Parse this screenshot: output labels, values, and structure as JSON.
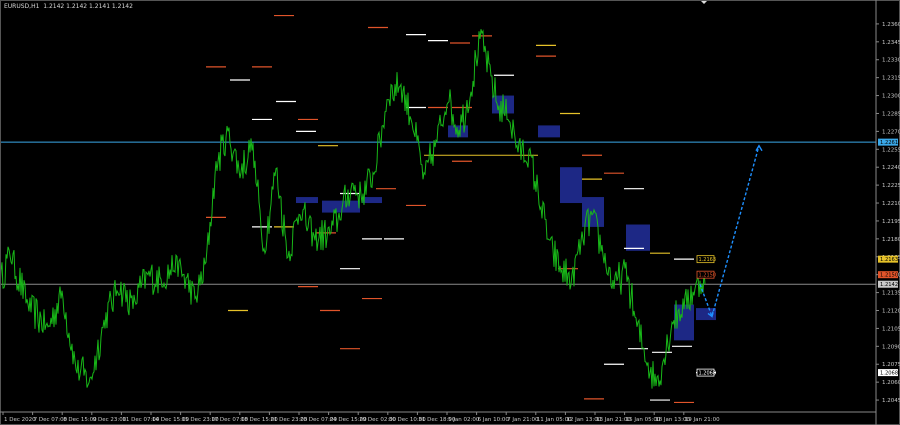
{
  "chart_data": {
    "type": "line",
    "symbol_header": "EURUSD,H1  1.2142 1.2142 1.2141 1.2142",
    "current_price": "1.2142",
    "ylim": [
      1.2035,
      1.2375
    ],
    "y_ticks": [
      "1.2360",
      "1.2345",
      "1.2330",
      "1.2315",
      "1.2300",
      "1.2285",
      "1.2270",
      "1.2255",
      "1.2240",
      "1.2225",
      "1.2210",
      "1.2195",
      "1.2180",
      "1.2165",
      "1.2150",
      "1.2135",
      "1.2120",
      "1.2105",
      "1.2090",
      "1.2075",
      "1.2060",
      "1.2045"
    ],
    "x_ticks": [
      "1 Dec 2020",
      "7 Dec 07:00",
      "8 Dec 15:00",
      "9 Dec 23:00",
      "11 Dec 07:00",
      "14 Dec 15:00",
      "15 Dec 23:00",
      "17 Dec 07:00",
      "18 Dec 15:00",
      "21 Dec 23:00",
      "23 Dec 07:00",
      "24 Dec 15:00",
      "29 Dec 02:00",
      "30 Dec 10:00",
      "31 Dec 18:00",
      "5 Jan 02:00",
      "6 Jan 10:00",
      "7 Jan 21:00",
      "11 Jan 05:00",
      "12 Jan 13:00",
      "13 Jan 21:00",
      "15 Jan 05:00",
      "18 Jan 13:00",
      "19 Jan 21:00"
    ],
    "key_points": [
      [
        0,
        1.2145
      ],
      [
        10,
        1.2168
      ],
      [
        28,
        1.2125
      ],
      [
        48,
        1.2105
      ],
      [
        62,
        1.2135
      ],
      [
        76,
        1.2072
      ],
      [
        90,
        1.206
      ],
      [
        104,
        1.211
      ],
      [
        118,
        1.214
      ],
      [
        133,
        1.2125
      ],
      [
        148,
        1.215
      ],
      [
        162,
        1.2145
      ],
      [
        176,
        1.216
      ],
      [
        196,
        1.213
      ],
      [
        206,
        1.216
      ],
      [
        216,
        1.224
      ],
      [
        228,
        1.227
      ],
      [
        240,
        1.2235
      ],
      [
        252,
        1.226
      ],
      [
        264,
        1.217
      ],
      [
        276,
        1.224
      ],
      [
        288,
        1.2165
      ],
      [
        300,
        1.2205
      ],
      [
        314,
        1.218
      ],
      [
        330,
        1.2185
      ],
      [
        340,
        1.22
      ],
      [
        352,
        1.2225
      ],
      [
        362,
        1.2215
      ],
      [
        374,
        1.2235
      ],
      [
        388,
        1.23
      ],
      [
        400,
        1.231
      ],
      [
        412,
        1.228
      ],
      [
        424,
        1.223
      ],
      [
        436,
        1.226
      ],
      [
        448,
        1.23
      ],
      [
        458,
        1.227
      ],
      [
        470,
        1.23
      ],
      [
        480,
        1.235
      ],
      [
        490,
        1.232
      ],
      [
        498,
        1.229
      ],
      [
        508,
        1.2285
      ],
      [
        518,
        1.2255
      ],
      [
        530,
        1.225
      ],
      [
        540,
        1.221
      ],
      [
        550,
        1.2175
      ],
      [
        560,
        1.2155
      ],
      [
        572,
        1.2145
      ],
      [
        582,
        1.218
      ],
      [
        592,
        1.22
      ],
      [
        604,
        1.2165
      ],
      [
        614,
        1.214
      ],
      [
        626,
        1.2155
      ],
      [
        636,
        1.211
      ],
      [
        646,
        1.208
      ],
      [
        656,
        1.206
      ],
      [
        664,
        1.208
      ],
      [
        672,
        1.211
      ],
      [
        684,
        1.2125
      ],
      [
        696,
        1.214
      ],
      [
        702,
        1.2145
      ],
      [
        705,
        1.2142
      ]
    ],
    "level_labels": [
      {
        "value": "1.2261",
        "color": "#3aa8e8"
      },
      {
        "value": "1.2163",
        "color": "#e6c229"
      },
      {
        "value": "1.2150",
        "color": "#e0542a"
      },
      {
        "value": "1.2142",
        "color": "#c8c8c8"
      },
      {
        "value": "1.2068",
        "color": "#ffffff"
      }
    ],
    "colors": {
      "background": "#000000",
      "price_line": "#18b818",
      "support_resistance": "#3aa8e8",
      "current_price_line": "#8a8a8a",
      "zone_fill": "#1f2a8c",
      "level_white": "#ffffff",
      "level_orange": "#e0542a",
      "level_yellow": "#e6c229",
      "projection": "#1e90ff"
    }
  }
}
